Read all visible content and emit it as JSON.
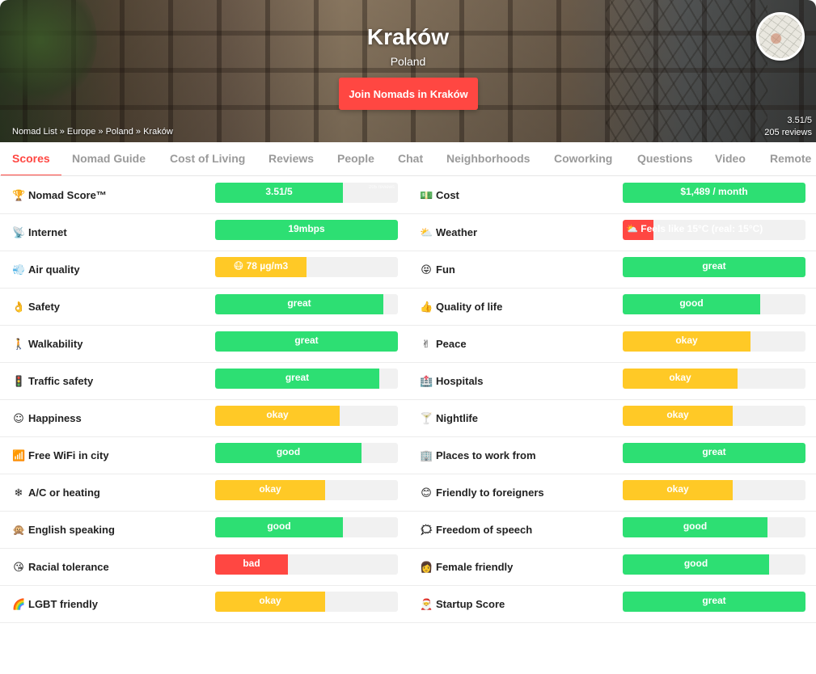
{
  "hero": {
    "city": "Kraków",
    "country": "Poland",
    "join_label": "Join Nomads in Kraków",
    "breadcrumb": [
      "Nomad List",
      "Europe",
      "Poland",
      "Kraków"
    ],
    "rating": "3.51/5",
    "reviews": "205 reviews"
  },
  "tabs": [
    "Scores",
    "Nomad Guide",
    "Cost of Living",
    "Reviews",
    "People",
    "Chat",
    "Neighborhoods",
    "Coworking",
    "Questions",
    "Video",
    "Remote"
  ],
  "colors": {
    "good": "#2ddf73",
    "okay": "#ffc926",
    "bad": "#ff4742",
    "track": "#f1f1f1"
  },
  "scores": {
    "left": [
      {
        "icon": "🏆",
        "icon_name": "trophy-icon",
        "label": "Nomad Score™",
        "value": "3.51/5",
        "level": 0.7,
        "color": "good",
        "note": "205 reviews"
      },
      {
        "icon": "📡",
        "icon_name": "satellite-dish-icon",
        "label": "Internet",
        "value": "19mbps",
        "level": 1.0,
        "color": "good"
      },
      {
        "icon": "💨",
        "icon_name": "wind-icon",
        "label": "Air quality",
        "value": "😷 78 µg/m3",
        "level": 0.5,
        "color": "okay"
      },
      {
        "icon": "👌",
        "icon_name": "ok-hand-icon",
        "label": "Safety",
        "value": "great",
        "level": 0.92,
        "color": "good"
      },
      {
        "icon": "🚶",
        "icon_name": "person-walking-icon",
        "label": "Walkability",
        "value": "great",
        "level": 1.0,
        "color": "good"
      },
      {
        "icon": "🚦",
        "icon_name": "traffic-light-icon",
        "label": "Traffic safety",
        "value": "great",
        "level": 0.9,
        "color": "good"
      },
      {
        "icon": "☺",
        "icon_name": "smile-icon",
        "label": "Happiness",
        "value": "okay",
        "level": 0.68,
        "color": "okay"
      },
      {
        "icon": "📶",
        "icon_name": "wifi-signal-icon",
        "label": "Free WiFi in city",
        "value": "good",
        "level": 0.8,
        "color": "good"
      },
      {
        "icon": "❄",
        "icon_name": "snowflake-icon",
        "label": "A/C or heating",
        "value": "okay",
        "level": 0.6,
        "color": "okay"
      },
      {
        "icon": "🙊",
        "icon_name": "speak-no-evil-monkey-icon",
        "label": "English speaking",
        "value": "good",
        "level": 0.7,
        "color": "good"
      },
      {
        "icon": "😘",
        "icon_name": "kiss-face-icon",
        "label": "Racial tolerance",
        "value": "bad",
        "level": 0.4,
        "color": "bad"
      },
      {
        "icon": "🌈",
        "icon_name": "rainbow-icon",
        "label": "LGBT friendly",
        "value": "okay",
        "level": 0.6,
        "color": "okay"
      }
    ],
    "right": [
      {
        "icon": "💵",
        "icon_name": "money-icon",
        "label": "Cost",
        "value": "$1,489 / month",
        "level": 1.0,
        "color": "good"
      },
      {
        "icon": "⛅",
        "icon_name": "cloud-sun-icon",
        "label": "Weather",
        "value": "⛅ Feels like 15°C (real: 15°C)",
        "level": 0.17,
        "color": "bad"
      },
      {
        "icon": "😝",
        "icon_name": "playful-face-icon",
        "label": "Fun",
        "value": "great",
        "level": 1.0,
        "color": "good"
      },
      {
        "icon": "👍",
        "icon_name": "thumbs-up-icon",
        "label": "Quality of life",
        "value": "good",
        "level": 0.75,
        "color": "good"
      },
      {
        "icon": "✌",
        "icon_name": "peace-hand-icon",
        "label": "Peace",
        "value": "okay",
        "level": 0.7,
        "color": "okay"
      },
      {
        "icon": "🏥",
        "icon_name": "hospital-icon",
        "label": "Hospitals",
        "value": "okay",
        "level": 0.63,
        "color": "okay"
      },
      {
        "icon": "🍸",
        "icon_name": "cocktail-icon",
        "label": "Nightlife",
        "value": "okay",
        "level": 0.6,
        "color": "okay"
      },
      {
        "icon": "🏢",
        "icon_name": "office-building-icon",
        "label": "Places to work from",
        "value": "great",
        "level": 1.0,
        "color": "good"
      },
      {
        "icon": "😊",
        "icon_name": "grinning-face-icon",
        "label": "Friendly to foreigners",
        "value": "okay",
        "level": 0.6,
        "color": "okay"
      },
      {
        "icon": "🗯",
        "icon_name": "speech-balloon-icon",
        "label": "Freedom of speech",
        "value": "good",
        "level": 0.79,
        "color": "good"
      },
      {
        "icon": "👩",
        "icon_name": "woman-icon",
        "label": "Female friendly",
        "value": "good",
        "level": 0.8,
        "color": "good"
      },
      {
        "icon": "🎅",
        "icon_name": "santa-icon",
        "label": "Startup Score",
        "value": "great",
        "level": 1.0,
        "color": "good"
      }
    ]
  }
}
